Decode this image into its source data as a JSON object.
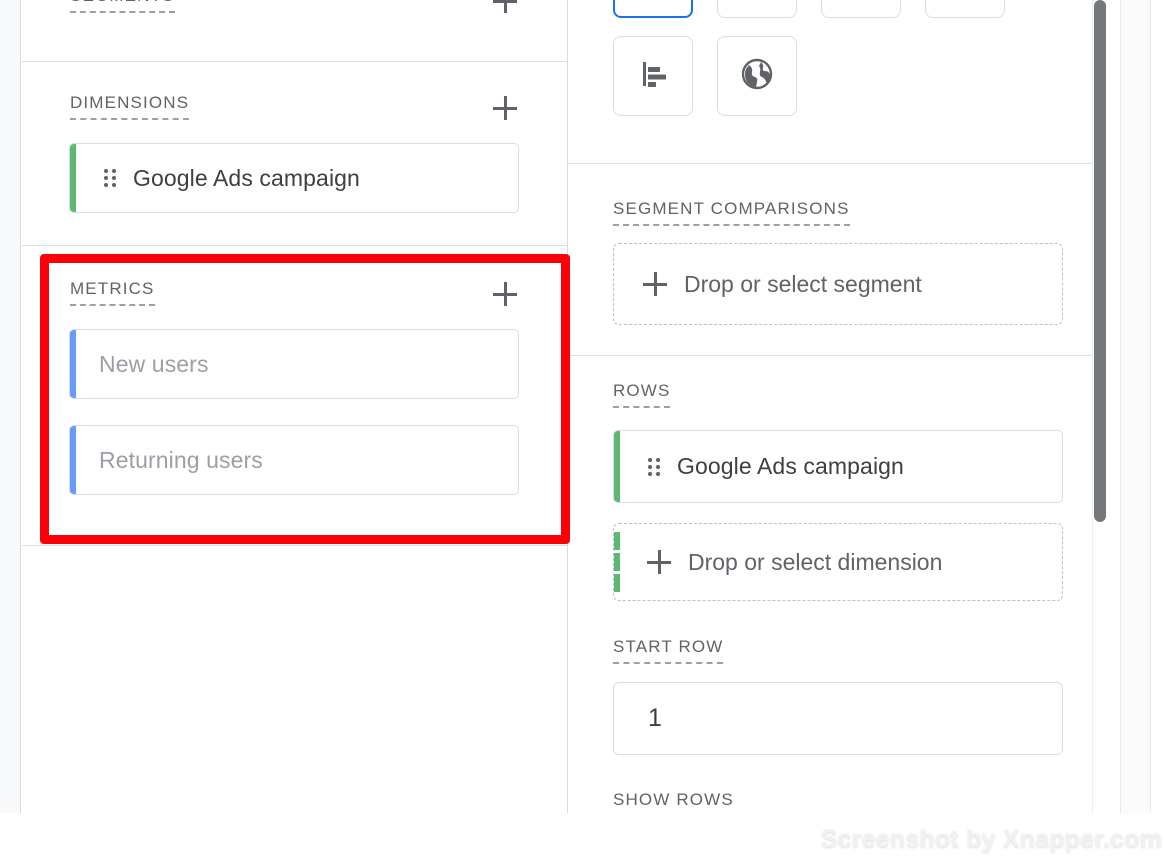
{
  "fields_panel": {
    "segments": {
      "title": "SEGMENTS",
      "add_label": "+"
    },
    "dimensions": {
      "title": "DIMENSIONS",
      "add_label": "+",
      "items": [
        {
          "label": "Google Ads campaign",
          "accent": "#5bb974"
        }
      ]
    },
    "metrics": {
      "title": "METRICS",
      "add_label": "+",
      "items": [
        {
          "label": "New users",
          "accent": "#669df6"
        },
        {
          "label": "Returning users",
          "accent": "#669df6"
        }
      ]
    }
  },
  "setup_panel": {
    "chart_types": [
      {
        "name": "chart-type-1",
        "selected": true
      },
      {
        "name": "chart-type-2",
        "selected": false
      },
      {
        "name": "chart-type-3",
        "selected": false
      },
      {
        "name": "chart-type-4",
        "selected": false
      }
    ],
    "chart_type_icons": [
      {
        "name": "bar-chart-icon"
      },
      {
        "name": "globe-icon"
      }
    ],
    "segment_comparisons": {
      "title": "SEGMENT COMPARISONS",
      "drop_label": "Drop or select segment"
    },
    "rows": {
      "title": "ROWS",
      "items": [
        {
          "label": "Google Ads campaign",
          "accent": "#5bb974"
        }
      ],
      "drop_label": "Drop or select dimension"
    },
    "start_row": {
      "title": "START ROW",
      "value": "1"
    },
    "show_rows": {
      "title": "SHOW ROWS"
    }
  },
  "annotation": {
    "highlight_color": "#fb0007",
    "target": "metrics"
  },
  "footer": {
    "watermark": "Screenshot by Xnapper.com"
  }
}
